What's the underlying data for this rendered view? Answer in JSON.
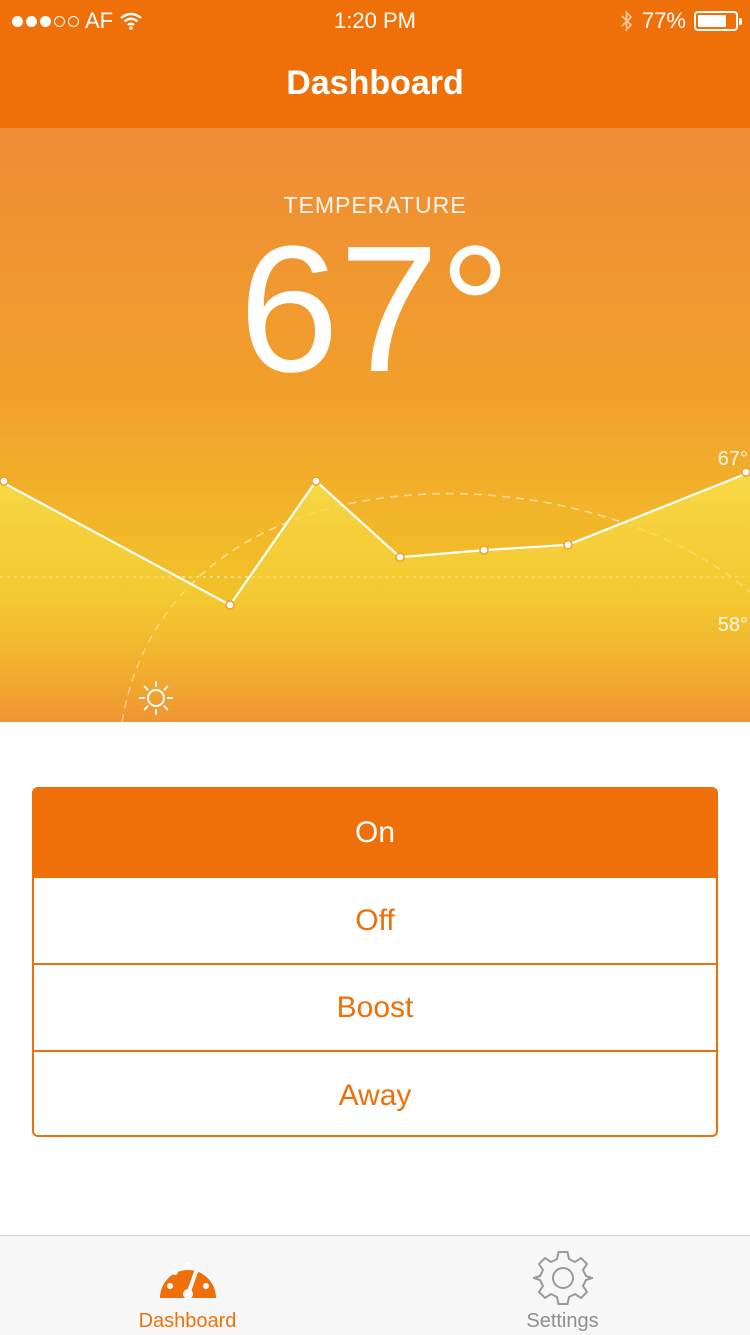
{
  "status_bar": {
    "carrier": "AF",
    "time": "1:20 PM",
    "battery_percent": "77%",
    "battery_level": 0.77,
    "signal_strength": 3,
    "signal_max": 5
  },
  "nav": {
    "title": "Dashboard"
  },
  "temperature": {
    "label": "TEMPERATURE",
    "value": "67°"
  },
  "chart_data": {
    "type": "area",
    "values": [
      67,
      60,
      67,
      62.7,
      63.1,
      63.4,
      67.5
    ],
    "labels": {
      "high": "67°",
      "low": "58°"
    }
  },
  "modes": {
    "items": [
      "On",
      "Off",
      "Boost",
      "Away"
    ],
    "selected": "On"
  },
  "tabs": [
    {
      "label": "Dashboard",
      "icon": "dashboard-gauge-icon",
      "selected": true
    },
    {
      "label": "Settings",
      "icon": "gear-icon",
      "selected": false
    }
  ],
  "colors": {
    "accent": "#ef7008",
    "hero_top": "#f08c35",
    "hero_mid": "#f2c228",
    "inactive_tab": "#8e8e93"
  }
}
